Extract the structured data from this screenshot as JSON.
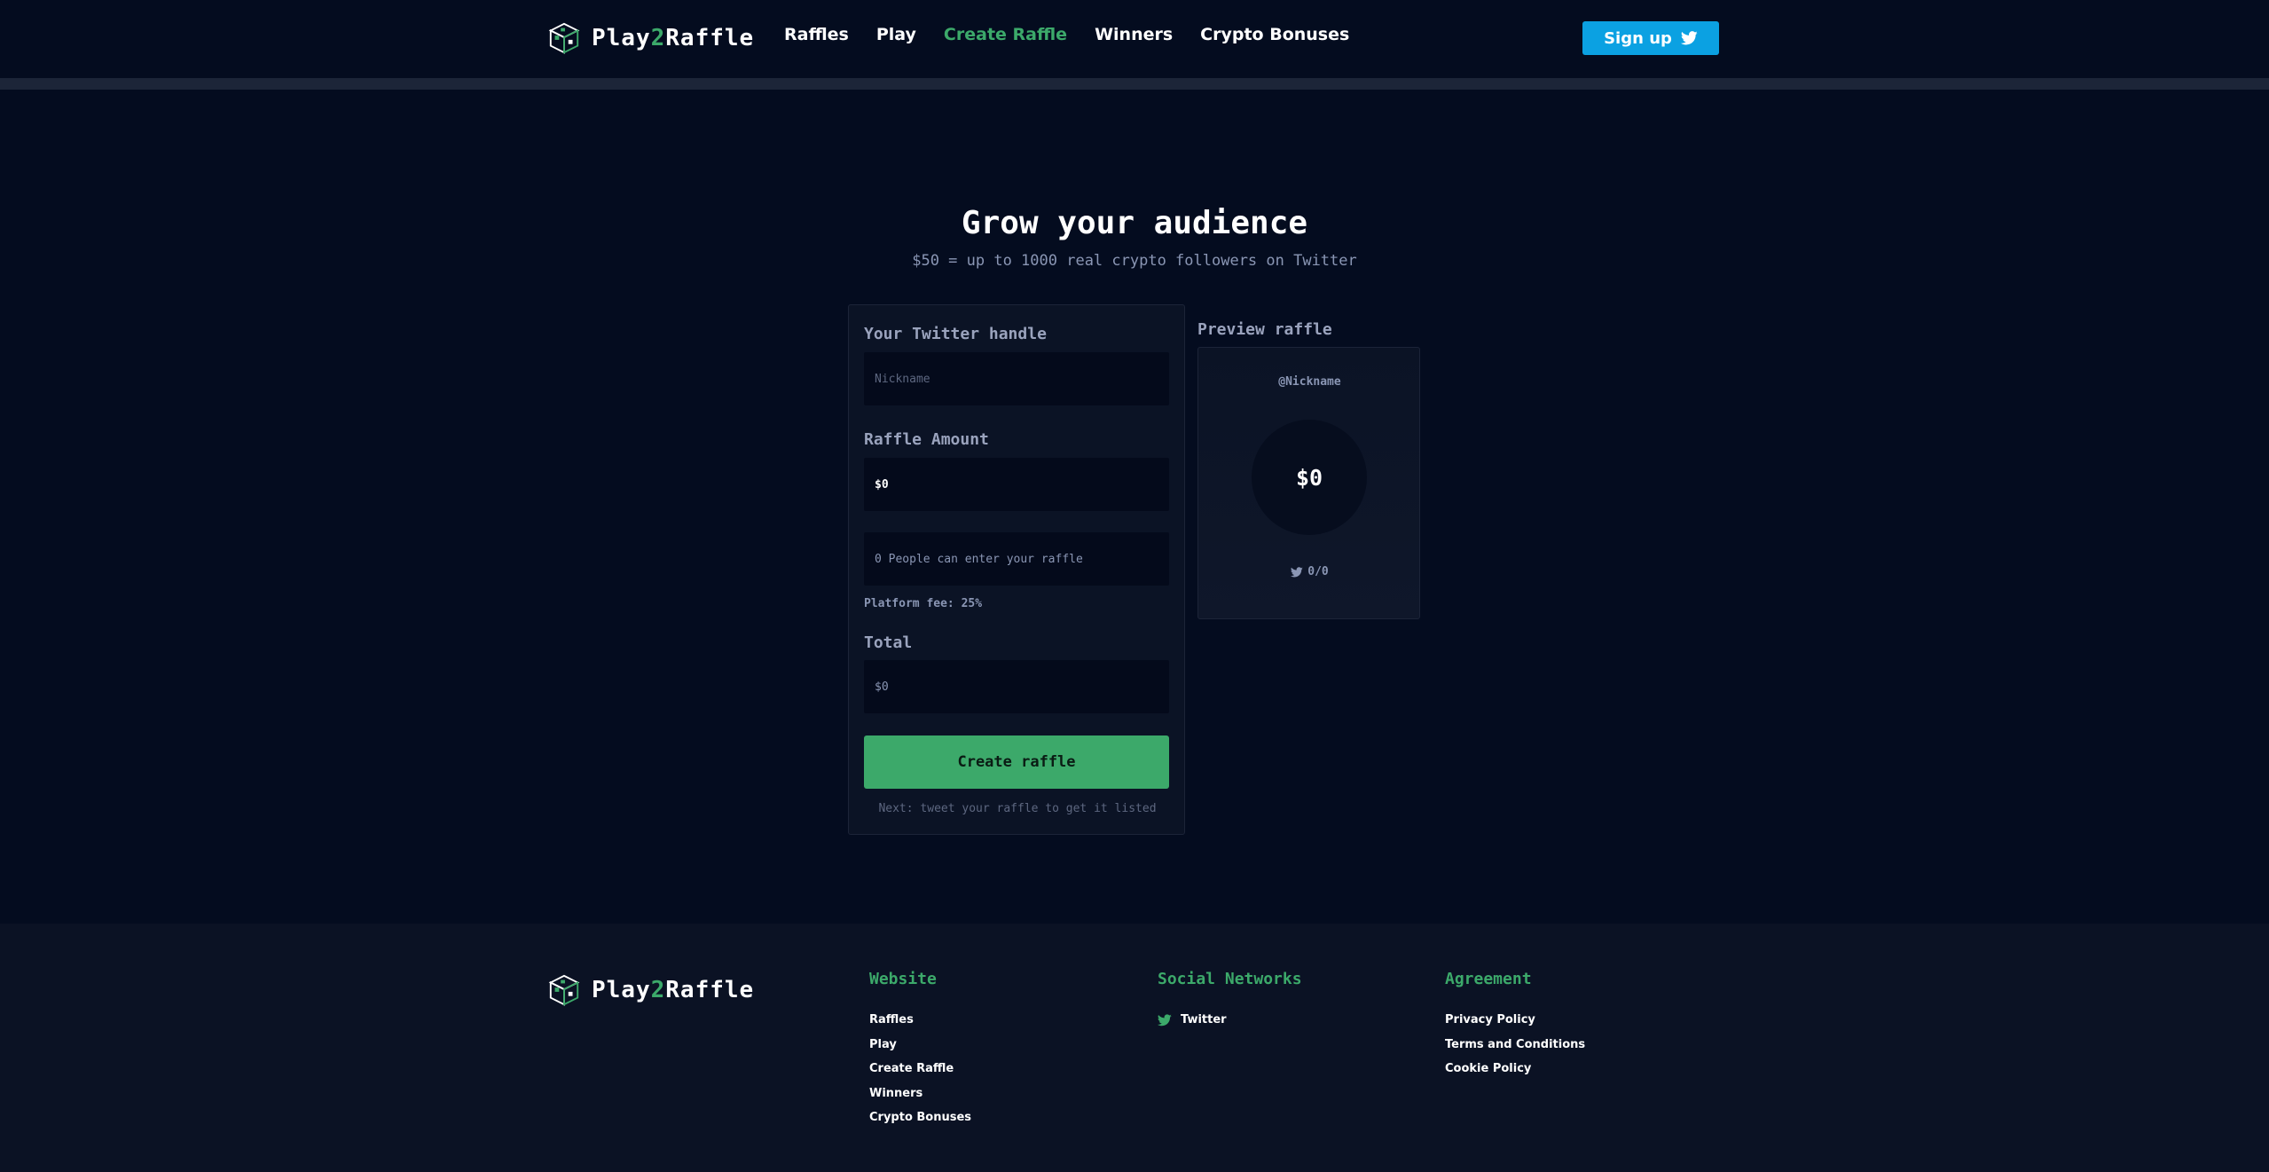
{
  "brand": {
    "name_part1": "Play",
    "name_accent": "2",
    "name_part2": "Raffle"
  },
  "nav": {
    "items": [
      {
        "label": "Raffles",
        "active": false
      },
      {
        "label": "Play",
        "active": false
      },
      {
        "label": "Create Raffle",
        "active": true
      },
      {
        "label": "Winners",
        "active": false
      },
      {
        "label": "Crypto Bonuses",
        "active": false
      }
    ],
    "signup_label": "Sign up"
  },
  "hero": {
    "title": "Grow your audience",
    "subtitle": "$50 = up to 1000 real crypto followers on Twitter"
  },
  "form": {
    "handle_label": "Your Twitter handle",
    "handle_placeholder": "Nickname",
    "amount_label": "Raffle Amount",
    "amount_value": "$0",
    "people_text": "0 People can enter your raffle",
    "fee_text": "Platform fee: 25%",
    "total_label": "Total",
    "total_value": "$0",
    "create_button": "Create raffle",
    "next_note": "Next: tweet your raffle to get it listed"
  },
  "preview": {
    "label": "Preview raffle",
    "handle": "@Nickname",
    "amount": "$0",
    "count": "0/0"
  },
  "footer": {
    "website": {
      "heading": "Website",
      "links": [
        "Raffles",
        "Play",
        "Create Raffle",
        "Winners",
        "Crypto Bonuses"
      ]
    },
    "social": {
      "heading": "Social Networks",
      "links": [
        "Twitter"
      ]
    },
    "agreement": {
      "heading": "Agreement",
      "links": [
        "Privacy Policy",
        "Terms and Conditions",
        "Cookie Policy"
      ]
    }
  },
  "colors": {
    "background": "#040c1f",
    "accent": "#3ca96a",
    "twitter": "#0ba1e2",
    "muted": "#8a96b4"
  },
  "icons": {
    "logo": "cube-logo-icon",
    "twitter": "twitter-bird-icon"
  }
}
